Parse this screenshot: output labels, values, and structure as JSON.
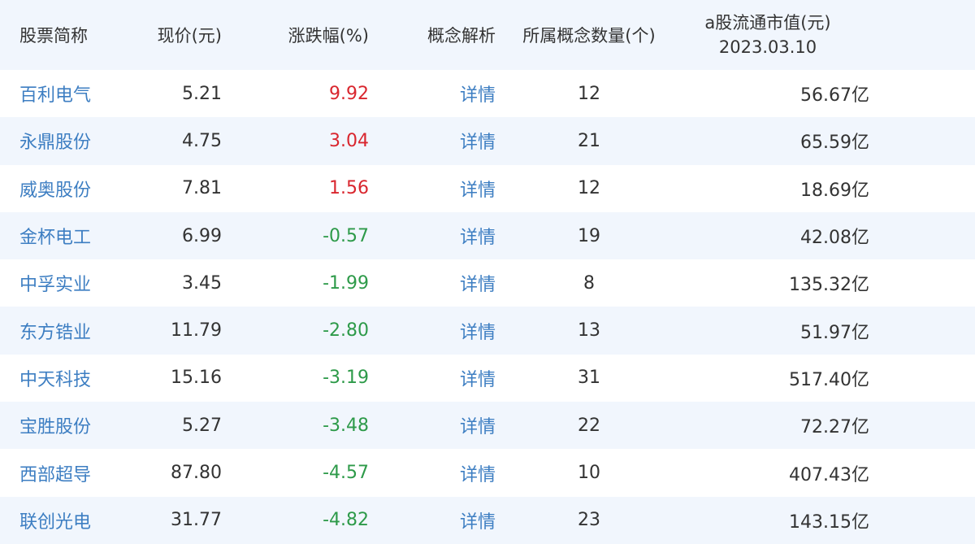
{
  "columns": {
    "name": "股票简称",
    "price": "现价(元)",
    "change": "涨跌幅(%)",
    "detail": "概念解析",
    "count": "所属概念数量(个)",
    "cap_line1": "a股流通市值(元)",
    "cap_line2": "2023.03.10"
  },
  "colors": {
    "up": "#d9262e",
    "down": "#2d9a49",
    "link": "#3d7ec2",
    "header_bg": "#f1f6fd"
  },
  "rows": [
    {
      "name": "百利电气",
      "price": "5.21",
      "change": "9.92",
      "detail": "详情",
      "count": "12",
      "cap": "56.67亿"
    },
    {
      "name": "永鼎股份",
      "price": "4.75",
      "change": "3.04",
      "detail": "详情",
      "count": "21",
      "cap": "65.59亿"
    },
    {
      "name": "威奥股份",
      "price": "7.81",
      "change": "1.56",
      "detail": "详情",
      "count": "12",
      "cap": "18.69亿"
    },
    {
      "name": "金杯电工",
      "price": "6.99",
      "change": "-0.57",
      "detail": "详情",
      "count": "19",
      "cap": "42.08亿"
    },
    {
      "name": "中孚实业",
      "price": "3.45",
      "change": "-1.99",
      "detail": "详情",
      "count": "8",
      "cap": "135.32亿"
    },
    {
      "name": "东方锆业",
      "price": "11.79",
      "change": "-2.80",
      "detail": "详情",
      "count": "13",
      "cap": "51.97亿"
    },
    {
      "name": "中天科技",
      "price": "15.16",
      "change": "-3.19",
      "detail": "详情",
      "count": "31",
      "cap": "517.40亿"
    },
    {
      "name": "宝胜股份",
      "price": "5.27",
      "change": "-3.48",
      "detail": "详情",
      "count": "22",
      "cap": "72.27亿"
    },
    {
      "name": "西部超导",
      "price": "87.80",
      "change": "-4.57",
      "detail": "详情",
      "count": "10",
      "cap": "407.43亿"
    },
    {
      "name": "联创光电",
      "price": "31.77",
      "change": "-4.82",
      "detail": "详情",
      "count": "23",
      "cap": "143.15亿"
    }
  ]
}
